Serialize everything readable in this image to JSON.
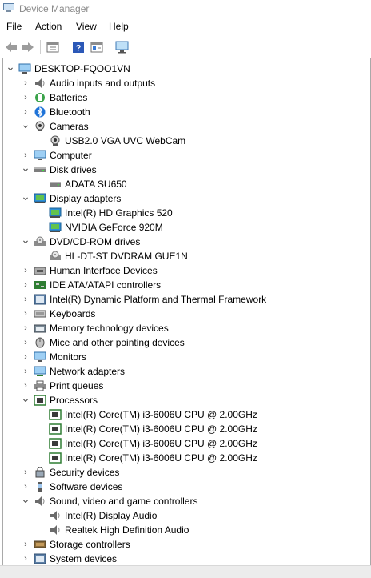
{
  "window": {
    "title": "Device Manager"
  },
  "menu": [
    {
      "label": "File"
    },
    {
      "label": "Action"
    },
    {
      "label": "View"
    },
    {
      "label": "Help"
    }
  ],
  "toolbar": [
    {
      "icon": "back-arrow-icon"
    },
    {
      "icon": "forward-arrow-icon"
    },
    {
      "icon": "properties-icon"
    },
    {
      "icon": "help-icon"
    },
    {
      "icon": "update-driver-icon"
    },
    {
      "icon": "scan-hardware-icon"
    }
  ],
  "tree": [
    {
      "label": "DESKTOP-FQOO1VN",
      "level": 0,
      "state": "expanded",
      "icon": "computer-icon"
    },
    {
      "label": "Audio inputs and outputs",
      "level": 1,
      "state": "collapsed",
      "icon": "speaker-icon"
    },
    {
      "label": "Batteries",
      "level": 1,
      "state": "collapsed",
      "icon": "battery-icon"
    },
    {
      "label": "Bluetooth",
      "level": 1,
      "state": "collapsed",
      "icon": "bluetooth-icon"
    },
    {
      "label": "Cameras",
      "level": 1,
      "state": "expanded",
      "icon": "camera-icon"
    },
    {
      "label": "USB2.0 VGA UVC WebCam",
      "level": 2,
      "state": "leaf",
      "icon": "camera-icon"
    },
    {
      "label": "Computer",
      "level": 1,
      "state": "collapsed",
      "icon": "monitor-icon"
    },
    {
      "label": "Disk drives",
      "level": 1,
      "state": "expanded",
      "icon": "disk-drive-icon"
    },
    {
      "label": "ADATA SU650",
      "level": 2,
      "state": "leaf",
      "icon": "disk-drive-icon"
    },
    {
      "label": "Display adapters",
      "level": 1,
      "state": "expanded",
      "icon": "display-adapter-icon"
    },
    {
      "label": "Intel(R) HD Graphics 520",
      "level": 2,
      "state": "leaf",
      "icon": "display-adapter-icon"
    },
    {
      "label": "NVIDIA GeForce 920M",
      "level": 2,
      "state": "leaf",
      "icon": "display-adapter-icon"
    },
    {
      "label": "DVD/CD-ROM drives",
      "level": 1,
      "state": "expanded",
      "icon": "dvd-drive-icon"
    },
    {
      "label": "HL-DT-ST DVDRAM GUE1N",
      "level": 2,
      "state": "leaf",
      "icon": "dvd-drive-icon"
    },
    {
      "label": "Human Interface Devices",
      "level": 1,
      "state": "collapsed",
      "icon": "hid-icon"
    },
    {
      "label": "IDE ATA/ATAPI controllers",
      "level": 1,
      "state": "collapsed",
      "icon": "ide-controller-icon"
    },
    {
      "label": "Intel(R) Dynamic Platform and Thermal Framework",
      "level": 1,
      "state": "collapsed",
      "icon": "system-device-icon"
    },
    {
      "label": "Keyboards",
      "level": 1,
      "state": "collapsed",
      "icon": "keyboard-icon"
    },
    {
      "label": "Memory technology devices",
      "level": 1,
      "state": "collapsed",
      "icon": "memory-icon"
    },
    {
      "label": "Mice and other pointing devices",
      "level": 1,
      "state": "collapsed",
      "icon": "mouse-icon"
    },
    {
      "label": "Monitors",
      "level": 1,
      "state": "collapsed",
      "icon": "monitor-icon"
    },
    {
      "label": "Network adapters",
      "level": 1,
      "state": "collapsed",
      "icon": "network-adapter-icon"
    },
    {
      "label": "Print queues",
      "level": 1,
      "state": "collapsed",
      "icon": "printer-icon"
    },
    {
      "label": "Processors",
      "level": 1,
      "state": "expanded",
      "icon": "processor-icon"
    },
    {
      "label": "Intel(R) Core(TM) i3-6006U CPU @ 2.00GHz",
      "level": 2,
      "state": "leaf",
      "icon": "processor-icon"
    },
    {
      "label": "Intel(R) Core(TM) i3-6006U CPU @ 2.00GHz",
      "level": 2,
      "state": "leaf",
      "icon": "processor-icon"
    },
    {
      "label": "Intel(R) Core(TM) i3-6006U CPU @ 2.00GHz",
      "level": 2,
      "state": "leaf",
      "icon": "processor-icon"
    },
    {
      "label": "Intel(R) Core(TM) i3-6006U CPU @ 2.00GHz",
      "level": 2,
      "state": "leaf",
      "icon": "processor-icon"
    },
    {
      "label": "Security devices",
      "level": 1,
      "state": "collapsed",
      "icon": "security-device-icon"
    },
    {
      "label": "Software devices",
      "level": 1,
      "state": "collapsed",
      "icon": "software-device-icon"
    },
    {
      "label": "Sound, video and game controllers",
      "level": 1,
      "state": "expanded",
      "icon": "speaker-icon"
    },
    {
      "label": "Intel(R) Display Audio",
      "level": 2,
      "state": "leaf",
      "icon": "speaker-icon"
    },
    {
      "label": "Realtek High Definition Audio",
      "level": 2,
      "state": "leaf",
      "icon": "speaker-icon"
    },
    {
      "label": "Storage controllers",
      "level": 1,
      "state": "collapsed",
      "icon": "storage-controller-icon"
    },
    {
      "label": "System devices",
      "level": 1,
      "state": "collapsed",
      "icon": "system-device-icon"
    }
  ]
}
